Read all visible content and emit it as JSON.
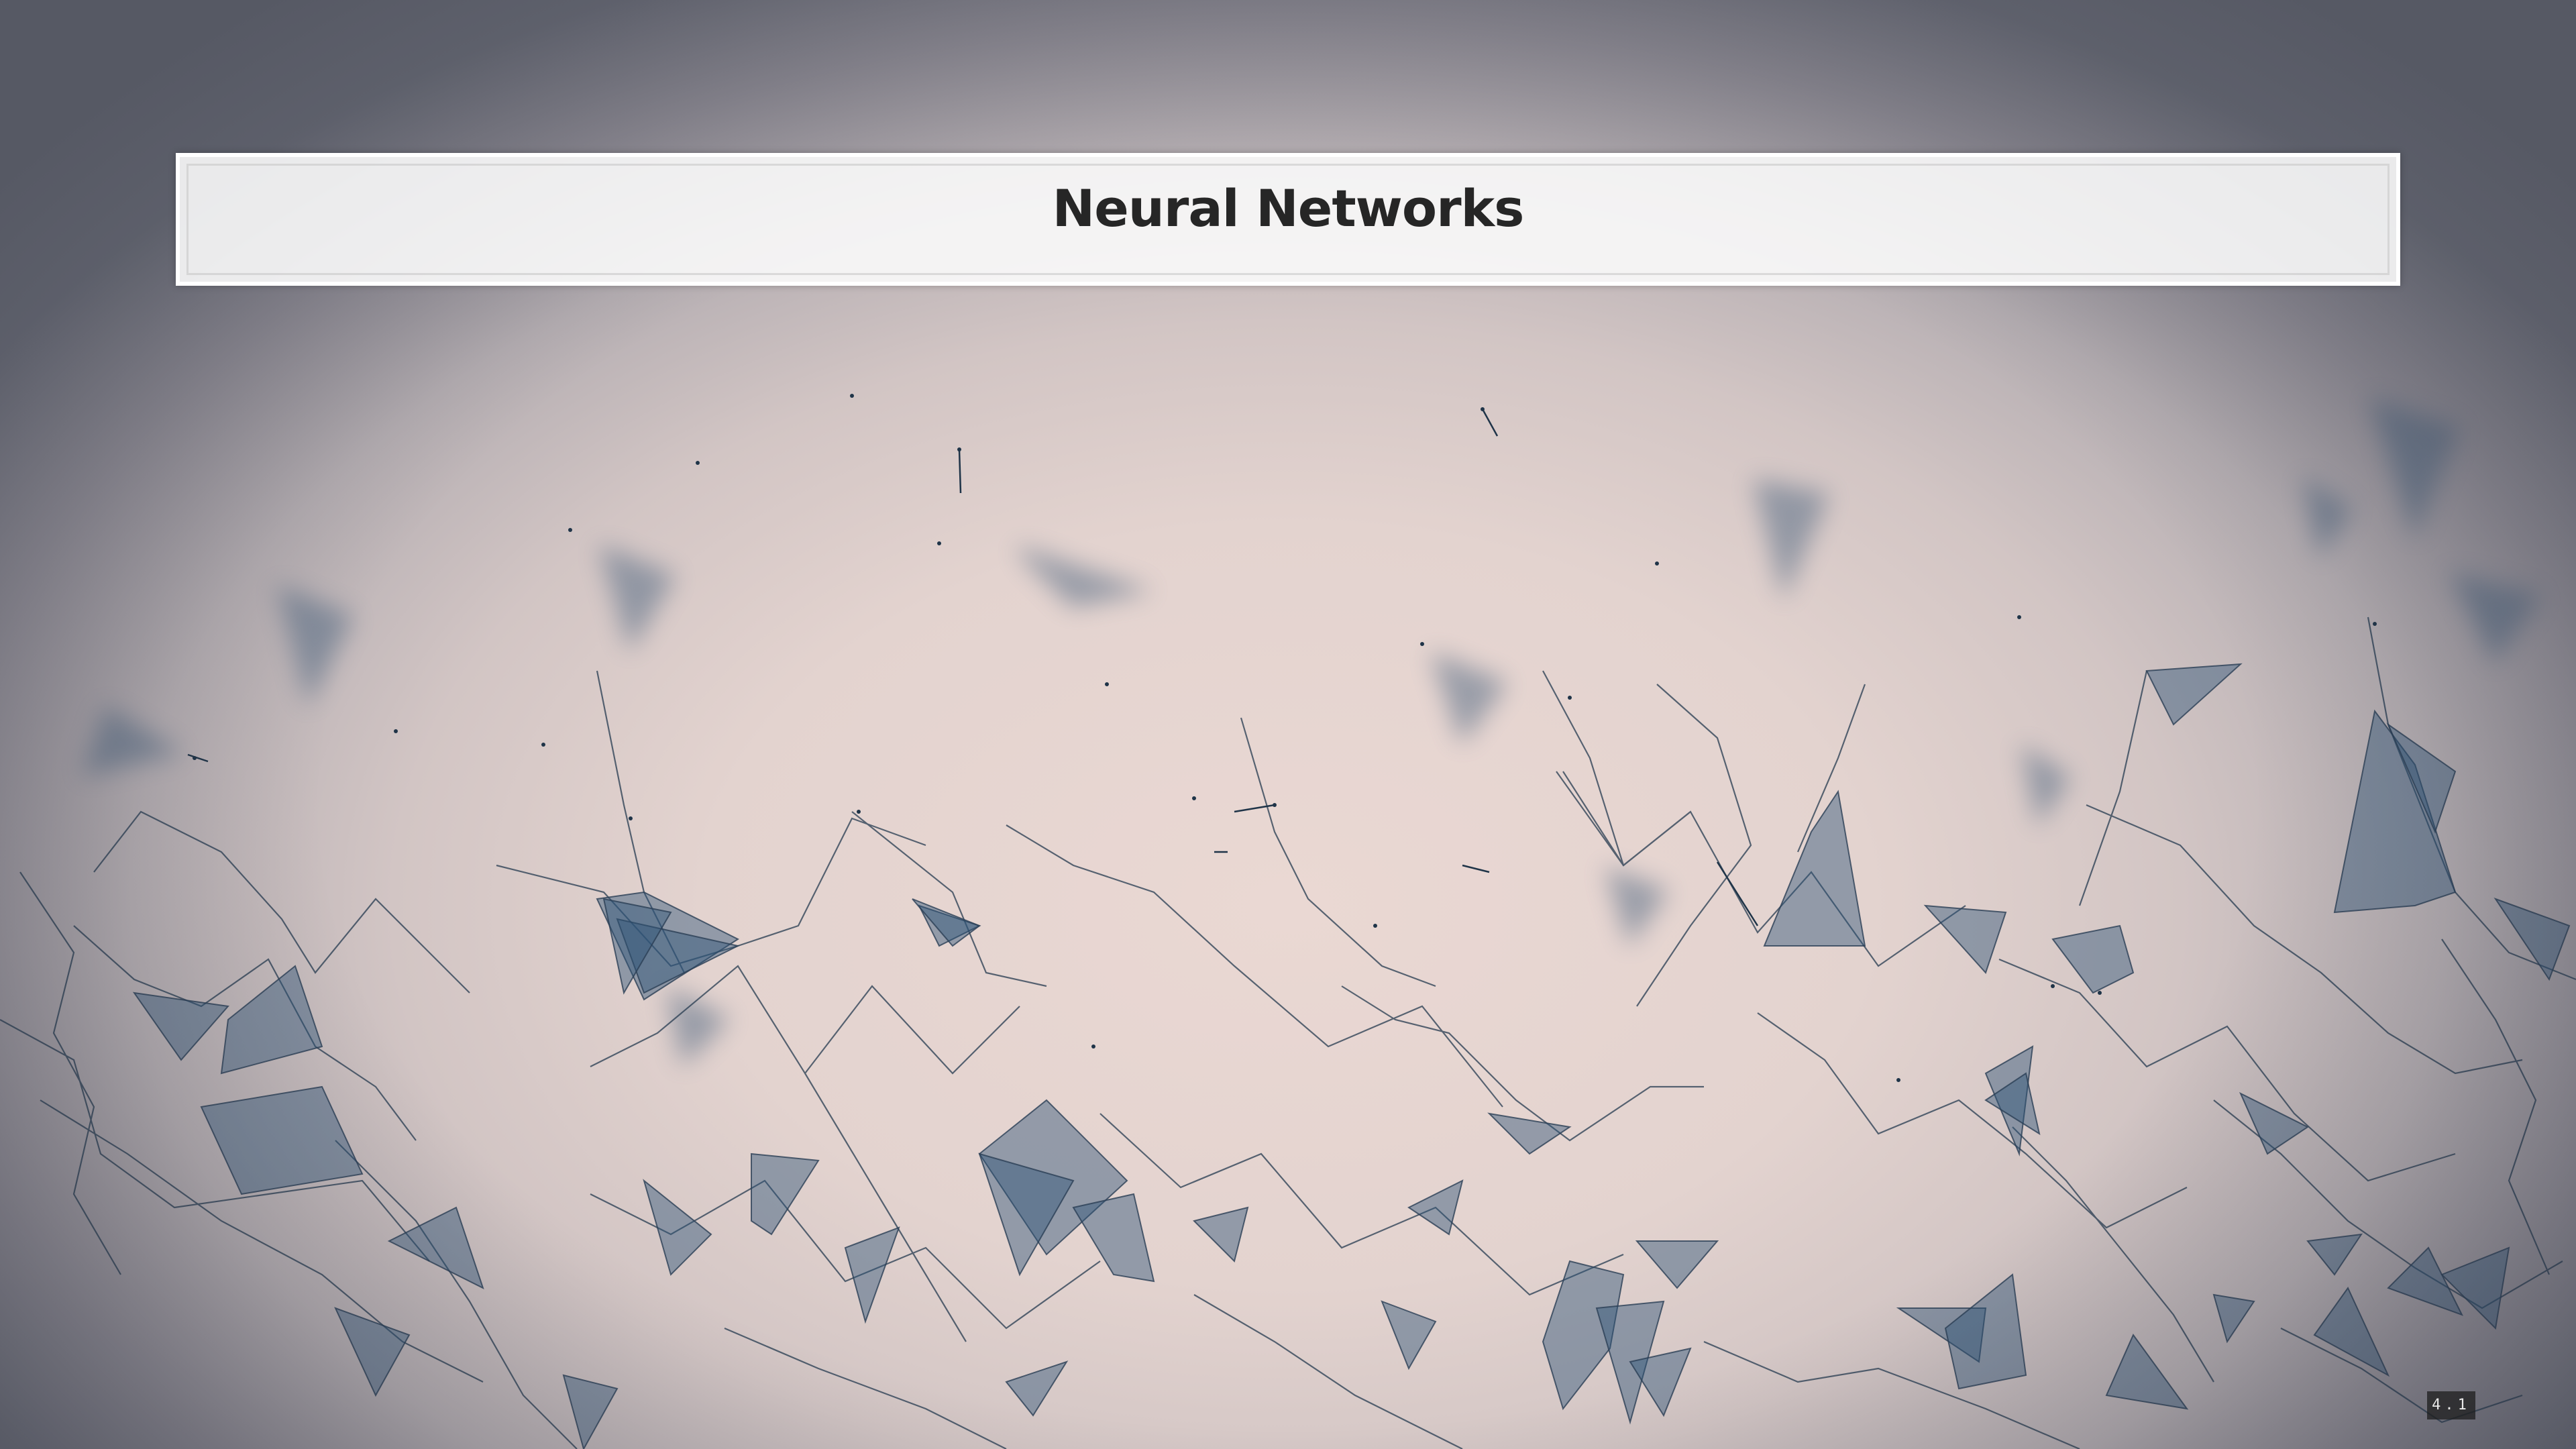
{
  "slide": {
    "title": "Neural Networks",
    "slide_number": "4.1"
  },
  "colors": {
    "network_fill": "#2f5478",
    "network_line": "#2a3f55",
    "title_text": "#262626"
  },
  "background": {
    "description_icon": "polygon-network-background"
  }
}
